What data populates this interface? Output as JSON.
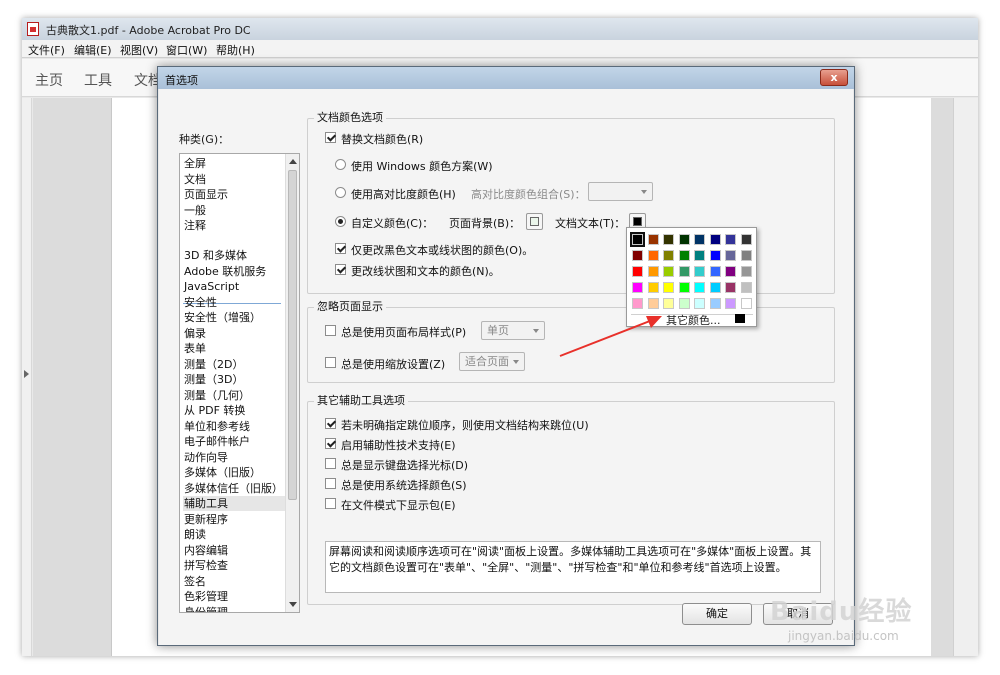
{
  "window": {
    "title": "古典散文1.pdf - Adobe Acrobat Pro DC"
  },
  "menubar": [
    "文件(F)",
    "编辑(E)",
    "视图(V)",
    "窗口(W)",
    "帮助(H)"
  ],
  "tabs": [
    "主页",
    "工具",
    "文档"
  ],
  "dialog": {
    "title": "首选项",
    "close": "x",
    "categories_label": "种类(G)：",
    "categories_top": [
      "全屏",
      "文档",
      "页面显示",
      "一般",
      "注释"
    ],
    "categories": [
      "3D 和多媒体",
      "Adobe 联机服务",
      "JavaScript",
      "安全性",
      "安全性（增强）",
      "偏录",
      "表单",
      "测量（2D）",
      "测量（3D）",
      "测量（几何）",
      "从 PDF 转换",
      "单位和参考线",
      "电子邮件帐户",
      "动作向导",
      "多媒体（旧版）",
      "多媒体信任（旧版）",
      "辅助工具",
      "更新程序",
      "朗读",
      "内容编辑",
      "拼写检查",
      "签名",
      "色彩管理",
      "身份管理"
    ],
    "selected_category": "辅助工具",
    "doc_color": {
      "title": "文档颜色选项",
      "replace": "替换文档颜色(R)",
      "use_windows": "使用 Windows 颜色方案(W)",
      "use_high_contrast": "使用高对比度颜色(H)",
      "high_contrast_combo_label": "高对比度颜色组合(S)：",
      "custom": "自定义颜色(C)：",
      "page_bg_label": "页面背景(B)：",
      "doc_text_label": "文档文本(T)：",
      "only_black": "仅更改黑色文本或线状图的颜色(O)。",
      "change_line": "更改线状图和文本的颜色(N)。"
    },
    "override_page": {
      "title": "忽略页面显示",
      "always_layout": "总是使用页面布局样式(P)",
      "layout_value": "单页",
      "always_zoom": "总是使用缩放设置(Z)",
      "zoom_value": "适合页面"
    },
    "other_tools": {
      "title": "其它辅助工具选项",
      "tab_order": "若未明确指定跳位顺序，则使用文档结构来跳位(U)",
      "assistive": "启用辅助性技术支持(E)",
      "keyboard_cursor": "总是显示键盘选择光标(D)",
      "system_color": "总是使用系统选择颜色(S)",
      "text_mode_bag": "在文件模式下显示包(E)"
    },
    "info_text": "屏幕阅读和阅读顺序选项可在\"阅读\"面板上设置。多媒体辅助工具选项可在\"多媒体\"面板上设置。其它的文档颜色设置可在\"表单\"、\"全屏\"、\"测量\"、\"拼写检查\"和\"单位和参考线\"首选项上设置。",
    "ok": "确定",
    "cancel": "取消"
  },
  "palette": {
    "more_colors": "其它颜色...",
    "rows": [
      [
        "#000000",
        "#993300",
        "#333300",
        "#003300",
        "#003366",
        "#000080",
        "#333399",
        "#333333"
      ],
      [
        "#800000",
        "#FF6600",
        "#808000",
        "#008000",
        "#008080",
        "#0000FF",
        "#666699",
        "#808080"
      ],
      [
        "#FF0000",
        "#FF9900",
        "#99CC00",
        "#339966",
        "#33CCCC",
        "#3366FF",
        "#800080",
        "#969696"
      ],
      [
        "#FF00FF",
        "#FFCC00",
        "#FFFF00",
        "#00FF00",
        "#00FFFF",
        "#00CCFF",
        "#993366",
        "#C0C0C0"
      ],
      [
        "#FF99CC",
        "#FFCC99",
        "#FFFF99",
        "#CCFFCC",
        "#CCFFFF",
        "#99CCFF",
        "#CC99FF",
        "#FFFFFF"
      ]
    ]
  },
  "watermark": {
    "logo": "Baidu经验",
    "url": "jingyan.baidu.com"
  }
}
